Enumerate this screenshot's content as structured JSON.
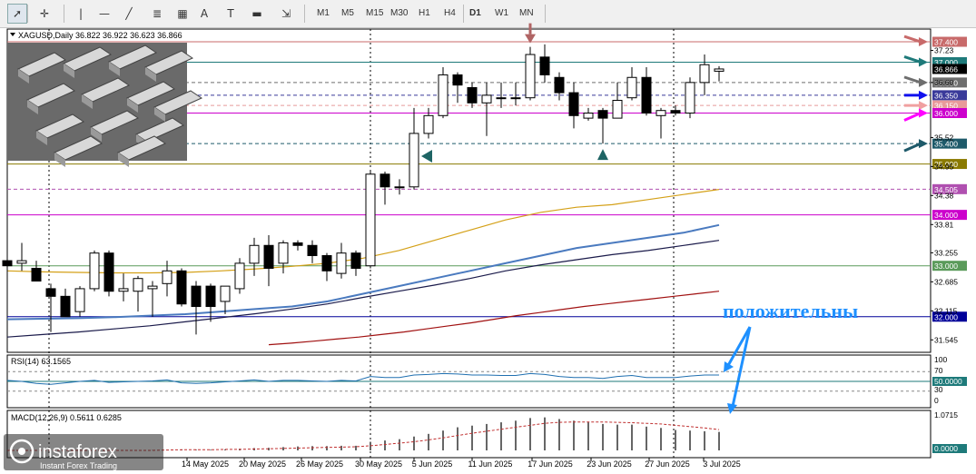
{
  "toolbar": {
    "tools": [
      {
        "name": "cursor-tool",
        "glyph": "➚"
      },
      {
        "name": "crosshair-tool",
        "glyph": "✛"
      },
      {
        "name": "vertical-line-tool",
        "glyph": "|"
      },
      {
        "name": "horizontal-line-tool",
        "glyph": "—"
      },
      {
        "name": "trendline-tool",
        "glyph": "╱"
      },
      {
        "name": "fibonacci-tool",
        "glyph": "≣"
      },
      {
        "name": "channel-tool",
        "glyph": "▦"
      },
      {
        "name": "text-tool",
        "glyph": "A"
      },
      {
        "name": "text-label-tool",
        "glyph": "T"
      },
      {
        "name": "rectangle-tool",
        "glyph": "▬"
      },
      {
        "name": "arrow-shapes-tool",
        "glyph": "⇲"
      }
    ],
    "timeframes": [
      "M1",
      "M5",
      "M15",
      "M30",
      "H1",
      "H4",
      "D1",
      "W1",
      "MN"
    ],
    "active_timeframe": "D1"
  },
  "header": {
    "symbol_line": "XAGUSD,Daily  36.822 36.922 36.623 36.866"
  },
  "annotation": {
    "text": "положительны",
    "color": "#1e90ff"
  },
  "watermark": {
    "brand": "instaforex",
    "tagline": "Instant Forex Trading"
  },
  "chart_data": {
    "type": "candlestick",
    "symbol": "XAGUSD",
    "timeframe": "Daily",
    "ohlc_header": {
      "open": 36.822,
      "high": 36.922,
      "low": 36.623,
      "close": 36.866
    },
    "ylim": [
      31.3,
      37.65
    ],
    "y_ticks": [
      37.23,
      36.6,
      35.52,
      34.95,
      34.38,
      33.81,
      33.255,
      32.685,
      32.115,
      31.545
    ],
    "x_tick_labels": [
      "14 May 2025",
      "20 May 2025",
      "26 May 2025",
      "30 May 2025",
      "5 Jun 2025",
      "11 Jun 2025",
      "17 Jun 2025",
      "23 Jun 2025",
      "27 Jun 2025",
      "3 Jul 2025"
    ],
    "candles": [
      {
        "o": 33.1,
        "h": 33.6,
        "l": 32.8,
        "c": 33.0
      },
      {
        "o": 33.05,
        "h": 33.45,
        "l": 32.9,
        "c": 33.1
      },
      {
        "o": 32.95,
        "h": 33.1,
        "l": 32.7,
        "c": 32.7
      },
      {
        "o": 32.55,
        "h": 32.65,
        "l": 31.7,
        "c": 32.4
      },
      {
        "o": 32.4,
        "h": 32.55,
        "l": 32.0,
        "c": 32.0
      },
      {
        "o": 32.1,
        "h": 32.6,
        "l": 32.0,
        "c": 32.55
      },
      {
        "o": 32.55,
        "h": 33.3,
        "l": 32.5,
        "c": 33.25
      },
      {
        "o": 33.25,
        "h": 33.3,
        "l": 32.4,
        "c": 32.5
      },
      {
        "o": 32.5,
        "h": 32.85,
        "l": 32.3,
        "c": 32.55
      },
      {
        "o": 32.5,
        "h": 32.8,
        "l": 32.1,
        "c": 32.75
      },
      {
        "o": 32.55,
        "h": 32.7,
        "l": 32.0,
        "c": 32.6
      },
      {
        "o": 32.65,
        "h": 33.1,
        "l": 32.4,
        "c": 32.9
      },
      {
        "o": 32.9,
        "h": 32.95,
        "l": 32.2,
        "c": 32.25
      },
      {
        "o": 32.6,
        "h": 32.7,
        "l": 31.65,
        "c": 32.2
      },
      {
        "o": 32.6,
        "h": 32.65,
        "l": 31.9,
        "c": 32.2
      },
      {
        "o": 32.3,
        "h": 32.6,
        "l": 32.05,
        "c": 32.6
      },
      {
        "o": 32.55,
        "h": 33.15,
        "l": 32.45,
        "c": 33.05
      },
      {
        "o": 33.05,
        "h": 33.55,
        "l": 32.8,
        "c": 33.4
      },
      {
        "o": 33.4,
        "h": 33.6,
        "l": 32.6,
        "c": 32.95
      },
      {
        "o": 33.05,
        "h": 33.5,
        "l": 32.85,
        "c": 33.45
      },
      {
        "o": 33.45,
        "h": 33.5,
        "l": 33.3,
        "c": 33.4
      },
      {
        "o": 33.4,
        "h": 33.5,
        "l": 33.05,
        "c": 33.2
      },
      {
        "o": 33.2,
        "h": 33.25,
        "l": 32.7,
        "c": 32.9
      },
      {
        "o": 32.85,
        "h": 33.45,
        "l": 32.75,
        "c": 33.25
      },
      {
        "o": 33.25,
        "h": 33.3,
        "l": 32.8,
        "c": 32.95
      },
      {
        "o": 33.0,
        "h": 34.85,
        "l": 32.95,
        "c": 34.8
      },
      {
        "o": 34.8,
        "h": 34.85,
        "l": 34.2,
        "c": 34.55
      },
      {
        "o": 34.55,
        "h": 34.7,
        "l": 34.4,
        "c": 34.55
      },
      {
        "o": 34.55,
        "h": 36.1,
        "l": 34.5,
        "c": 35.6
      },
      {
        "o": 35.6,
        "h": 36.1,
        "l": 35.5,
        "c": 35.95
      },
      {
        "o": 35.95,
        "h": 36.9,
        "l": 35.9,
        "c": 36.75
      },
      {
        "o": 36.75,
        "h": 36.8,
        "l": 36.2,
        "c": 36.55
      },
      {
        "o": 36.5,
        "h": 36.6,
        "l": 36.1,
        "c": 36.2
      },
      {
        "o": 36.2,
        "h": 36.6,
        "l": 35.55,
        "c": 36.35
      },
      {
        "o": 36.3,
        "h": 36.6,
        "l": 36.1,
        "c": 36.3
      },
      {
        "o": 36.3,
        "h": 36.6,
        "l": 36.15,
        "c": 36.3
      },
      {
        "o": 36.3,
        "h": 37.3,
        "l": 36.25,
        "c": 37.15
      },
      {
        "o": 37.1,
        "h": 37.35,
        "l": 36.6,
        "c": 36.75
      },
      {
        "o": 36.7,
        "h": 36.8,
        "l": 36.25,
        "c": 36.4
      },
      {
        "o": 36.4,
        "h": 36.6,
        "l": 35.7,
        "c": 35.95
      },
      {
        "o": 35.9,
        "h": 36.1,
        "l": 35.85,
        "c": 36.0
      },
      {
        "o": 36.05,
        "h": 36.1,
        "l": 35.4,
        "c": 35.9
      },
      {
        "o": 35.9,
        "h": 36.6,
        "l": 35.9,
        "c": 36.25
      },
      {
        "o": 36.3,
        "h": 36.9,
        "l": 36.25,
        "c": 36.7
      },
      {
        "o": 36.7,
        "h": 36.9,
        "l": 35.95,
        "c": 36.0
      },
      {
        "o": 35.95,
        "h": 36.1,
        "l": 35.5,
        "c": 36.05
      },
      {
        "o": 36.05,
        "h": 36.15,
        "l": 35.95,
        "c": 36.0
      },
      {
        "o": 36.0,
        "h": 36.7,
        "l": 35.9,
        "c": 36.6
      },
      {
        "o": 36.6,
        "h": 37.15,
        "l": 36.35,
        "c": 36.95
      },
      {
        "o": 36.822,
        "h": 36.922,
        "l": 36.623,
        "c": 36.866
      }
    ],
    "levels": [
      {
        "value": 37.4,
        "label": "37.400",
        "color": "#c86a6a",
        "style": "solid"
      },
      {
        "value": 37.0,
        "label": "37.000",
        "color": "#1e7a7a",
        "style": "solid"
      },
      {
        "value": 36.866,
        "label": "36.866",
        "color": "#000000",
        "style": "none"
      },
      {
        "value": 36.6,
        "label": "36.600",
        "color": "#6e6e6e",
        "style": "dash"
      },
      {
        "value": 36.35,
        "label": "36.350",
        "color": "#3a3a9a",
        "style": "dash"
      },
      {
        "value": 36.15,
        "label": "36.150",
        "color": "#e89a9a",
        "style": "dash"
      },
      {
        "value": 36.0,
        "label": "36.000",
        "color": "#cc00cc",
        "style": "solid"
      },
      {
        "value": 35.4,
        "label": "35.400",
        "color": "#1e5a6a",
        "style": "dash"
      },
      {
        "value": 35.0,
        "label": "35.000",
        "color": "#8a7a00",
        "style": "solid"
      },
      {
        "value": 34.505,
        "label": "34.505",
        "color": "#b050b0",
        "style": "dash"
      },
      {
        "value": 34.0,
        "label": "34.000",
        "color": "#cc00cc",
        "style": "solid"
      },
      {
        "value": 33.0,
        "label": "33.000",
        "color": "#5a9a5a",
        "style": "solid"
      },
      {
        "value": 32.0,
        "label": "32.000",
        "color": "#000099",
        "style": "solid"
      }
    ],
    "moving_averages": [
      {
        "color": "#d4a017",
        "values": [
          32.9,
          32.88,
          32.87,
          32.86,
          32.86,
          32.87,
          32.9,
          32.94,
          32.99,
          33.05,
          33.15,
          33.3,
          33.5,
          33.7,
          33.9,
          34.05,
          34.15,
          34.2,
          34.3,
          34.4,
          34.5
        ]
      },
      {
        "color": "#4a7abf",
        "values": [
          31.95,
          31.96,
          31.97,
          31.99,
          32.02,
          32.05,
          32.1,
          32.15,
          32.2,
          32.3,
          32.45,
          32.6,
          32.75,
          32.9,
          33.05,
          33.2,
          33.35,
          33.45,
          33.55,
          33.65,
          33.8
        ]
      },
      {
        "color": "#1a1a4a",
        "values": [
          31.6,
          31.65,
          31.7,
          31.76,
          31.82,
          31.9,
          31.98,
          32.06,
          32.15,
          32.25,
          32.38,
          32.5,
          32.62,
          32.75,
          32.9,
          33.02,
          33.12,
          33.22,
          33.3,
          33.4,
          33.5
        ]
      },
      {
        "color": "#a01010",
        "values": [
          31.45,
          31.48,
          31.52,
          31.56,
          31.6,
          31.65,
          31.7,
          31.76,
          31.82,
          31.88,
          31.95,
          32.02,
          32.08,
          32.14,
          32.2,
          32.25,
          32.3,
          32.35,
          32.4,
          32.45,
          32.5
        ]
      }
    ],
    "rsi": {
      "label": "RSI(14) 63.1565",
      "levels": [
        "100",
        "70",
        "30",
        "0"
      ],
      "marker": "50.0000"
    },
    "macd": {
      "label": "MACD(12,26,9) 0.5611 0.6285",
      "axis_top": "1.0715",
      "axis_zero": "0.0000"
    },
    "signals": [
      {
        "type": "arrow-down",
        "color": "#b06464",
        "candle": 36
      },
      {
        "type": "triangle-up",
        "color": "#1e6464",
        "candle": 41
      },
      {
        "type": "triangle-left",
        "color": "#1e6464",
        "candle": 29
      }
    ]
  }
}
